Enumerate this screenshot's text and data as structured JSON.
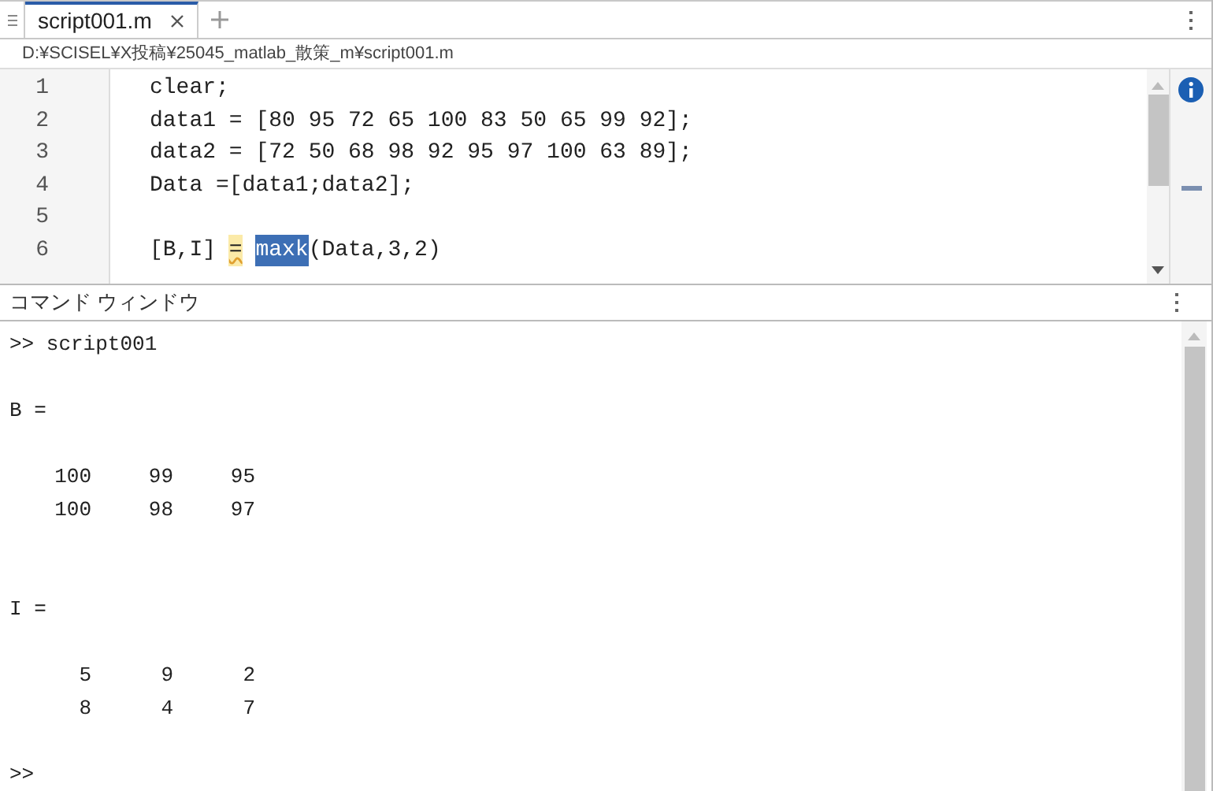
{
  "editor": {
    "tabs": [
      {
        "label": "script001.m",
        "selected": true
      }
    ],
    "path": "D:¥SCISEL¥X投稿¥25045_matlab_散策_m¥script001.m",
    "lines": [
      {
        "number": "1",
        "segments": [
          {
            "kind": "plain",
            "text": "clear;"
          }
        ]
      },
      {
        "number": "2",
        "segments": [
          {
            "kind": "plain",
            "text": "data1 = [80 95 72 65 100 83 50 65 99 92];"
          }
        ]
      },
      {
        "number": "3",
        "segments": [
          {
            "kind": "plain",
            "text": "data2 = [72 50 68 98 92 95 97 100 63 89];"
          }
        ]
      },
      {
        "number": "4",
        "segments": [
          {
            "kind": "plain",
            "text": "Data =[data1;data2];"
          }
        ]
      },
      {
        "number": "5"
      },
      {
        "number": "6",
        "segments": [
          {
            "kind": "plain",
            "text": "[B,I] "
          },
          {
            "kind": "warning",
            "text": "="
          },
          {
            "kind": "selected",
            "text": "maxk",
            "gap_before": true
          },
          {
            "kind": "plain",
            "text": "(Data,3,2)"
          }
        ]
      }
    ]
  },
  "command_window": {
    "title": "コマンド ウィンドウ",
    "entries": [
      {
        "kind": "command",
        "text": ">> script001"
      },
      {
        "kind": "gap"
      },
      {
        "kind": "output",
        "text": "B ="
      },
      {
        "kind": "gap"
      },
      {
        "kind": "matrix",
        "rows": [
          [
            "100",
            "99",
            "95"
          ],
          [
            "100",
            "98",
            "97"
          ]
        ]
      },
      {
        "kind": "gap"
      },
      {
        "kind": "gap"
      },
      {
        "kind": "output",
        "text": "I ="
      },
      {
        "kind": "gap"
      },
      {
        "kind": "matrix",
        "rows": [
          [
            "5",
            "9",
            "2"
          ],
          [
            "8",
            "4",
            "7"
          ]
        ]
      },
      {
        "kind": "gap"
      },
      {
        "kind": "command",
        "text": ">>"
      }
    ]
  }
}
